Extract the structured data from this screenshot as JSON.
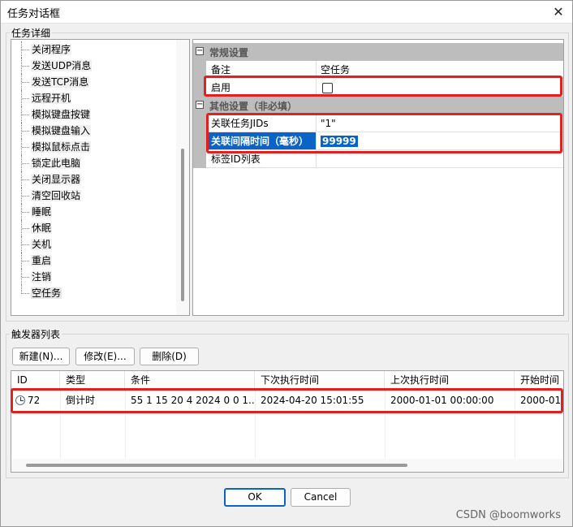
{
  "window": {
    "title": "任务对话框",
    "close_glyph": "✕"
  },
  "task_group": {
    "label": "任务详细"
  },
  "tree": {
    "items": [
      "关闭程序",
      "发送UDP消息",
      "发送TCP消息",
      "远程开机",
      "模拟键盘按键",
      "模拟键盘输入",
      "模拟鼠标点击",
      "锁定此电脑",
      "关闭显示器",
      "清空回收站",
      "睡眠",
      "休眠",
      "关机",
      "重启",
      "注销",
      "空任务"
    ]
  },
  "properties": {
    "cat_general": "常规设置",
    "cat_other": "其他设置（非必填）",
    "collapse_glyph": "⊟",
    "remark_name": "备注",
    "remark_value": "空任务",
    "enable_name": "启用",
    "related_ids_name": "关联任务JIDs",
    "related_ids_value": "\"1\"",
    "interval_name": "关联间隔时间（毫秒）",
    "interval_value": "99999",
    "tag_ids_name": "标签ID列表"
  },
  "trigger_group": {
    "label": "触发器列表"
  },
  "toolbar": {
    "new_label": "新建(N)...",
    "edit_label": "修改(E)...",
    "delete_label": "删除(D)"
  },
  "triggers": {
    "columns": [
      "ID",
      "类型",
      "条件",
      "下次执行时间",
      "上次执行时间",
      "开始时间"
    ],
    "row": {
      "id": "72",
      "type": "倒计时",
      "condition": "55 1 15 20 4 2024 0 0 1...",
      "next_run": "2024-04-20 15:01:55",
      "last_run": "2000-01-01 00:00:00",
      "start": "2000-01-..."
    }
  },
  "footer": {
    "ok_label": "OK",
    "cancel_label": "Cancel"
  },
  "watermark": "CSDN @boomworks",
  "colors": {
    "highlight": "#0a64c8",
    "annotation": "#e32020"
  }
}
